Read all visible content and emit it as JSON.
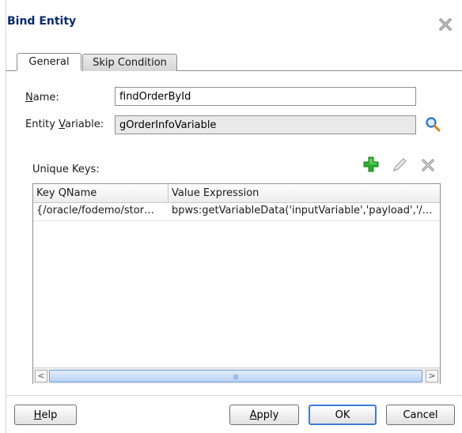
{
  "dialog": {
    "title": "Bind Entity"
  },
  "tabs": [
    {
      "label": "General",
      "selected": true
    },
    {
      "label": "Skip Condition",
      "selected": false
    }
  ],
  "form": {
    "name_label_u": "N",
    "name_label_rest": "ame:",
    "name_value": "findOrderById",
    "entity_label_pre": "Entity ",
    "entity_label_u": "V",
    "entity_label_rest": "ariable:",
    "entity_value": "gOrderInfoVariable"
  },
  "unique_keys": {
    "label": "Unique Keys:",
    "columns": [
      "Key QName",
      "Value Expression"
    ],
    "rows": [
      {
        "key_qname": "{/oracle/fodemo/stor…",
        "value_expression": "bpws:getVariableData('inputVariable','payload','/…"
      }
    ]
  },
  "buttons": {
    "help_u": "H",
    "help_rest": "elp",
    "apply_u": "A",
    "apply_rest": "pply",
    "ok": "OK",
    "cancel": "Cancel"
  },
  "icons": {
    "close": "close-icon",
    "search": "search-icon",
    "add": "add-icon",
    "edit": "edit-icon",
    "delete": "delete-icon"
  },
  "colors": {
    "title": "#0a2a6a",
    "add_green": "#2eae2e",
    "search_blue": "#2a6fc9",
    "ok_focus": "#3d7bd6"
  }
}
